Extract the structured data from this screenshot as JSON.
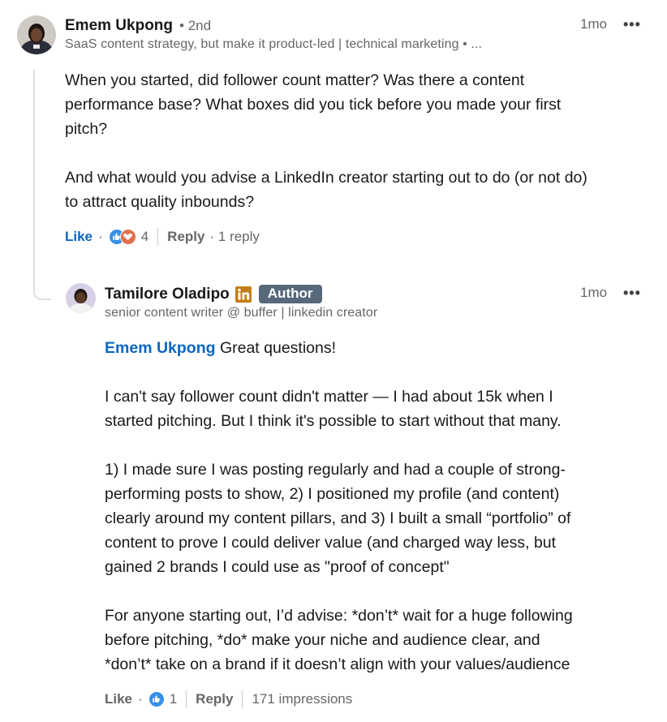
{
  "comment": {
    "author": "Emem Ukpong",
    "degree": "• 2nd",
    "headline": "SaaS content strategy, but make it product-led | technical marketing • ...",
    "time": "1mo",
    "more": "•••",
    "body": "When you started, did follower count matter? Was there a content\nperformance base? What boxes did you tick before you made your first\npitch?\n\nAnd what would you advise a LinkedIn creator starting out to do (or not do)\nto attract quality inbounds?",
    "actions": {
      "like_label": "Like",
      "dot": "·",
      "reaction_count": "4",
      "reply_label": "Reply",
      "reply_count": "· 1 reply"
    }
  },
  "reply": {
    "author": "Tamilore Oladipo",
    "badge": "Author",
    "headline": "senior content writer @ buffer | linkedin creator",
    "time": "1mo",
    "more": "•••",
    "mention": "Emem Ukpong",
    "body_first": " Great questions!",
    "body_rest": "I can't say follower count didn't matter — I had about 15k when I\nstarted pitching. But I think it's possible to start without that many.\n\n1) I made sure I was posting regularly and had a couple of strong-\nperforming posts to show, 2) I positioned my profile (and content)\nclearly around my content pillars, and 3) I built a small “portfolio” of\ncontent to prove I could deliver value (and charged way less, but\ngained 2 brands I could use as \"proof of concept\"\n\nFor anyone starting out, I’d advise: *don’t* wait for a huge following\nbefore pitching, *do* make your niche and audience clear, and\n*don’t* take on a brand if it doesn’t align with your values/audience",
    "actions": {
      "like_label": "Like",
      "dot": "·",
      "reaction_count": "1",
      "reply_label": "Reply",
      "impressions": "171 impressions"
    }
  },
  "colors": {
    "link_blue": "#0a66c2",
    "muted_gray": "#666666",
    "badge_bg": "#56687a",
    "like_reaction": "#378fe9",
    "love_reaction": "#df704d",
    "linkedin_premium": "#c37d16"
  },
  "icons": {
    "like_reaction": "thumbs-up-icon",
    "love_reaction": "heart-icon",
    "linkedin": "linkedin-premium-icon",
    "more": "more-horizontal-icon"
  }
}
